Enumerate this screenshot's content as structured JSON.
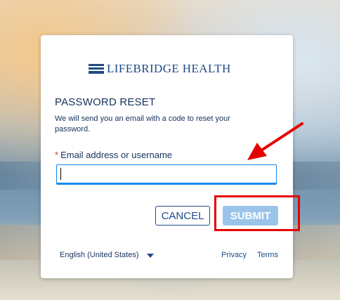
{
  "brand": {
    "logo_text": "LIFEBRIDGE HEALTH",
    "logo_icon": "lifebridge-logo-icon",
    "brand_color": "#1f4a87"
  },
  "form": {
    "title": "PASSWORD RESET",
    "description": "We will send you an email with a code to reset your password.",
    "field_label": "Email address or username",
    "required_marker": "*",
    "field_value": "",
    "field_placeholder": ""
  },
  "buttons": {
    "cancel_label": "CANCEL",
    "submit_label": "SUBMIT"
  },
  "footer": {
    "language": "English (United States)",
    "language_icon": "chevron-down-icon",
    "privacy": "Privacy",
    "terms": "Terms"
  },
  "annotations": {
    "arrow_icon": "red-arrow-icon",
    "highlight_color": "#e50000"
  }
}
